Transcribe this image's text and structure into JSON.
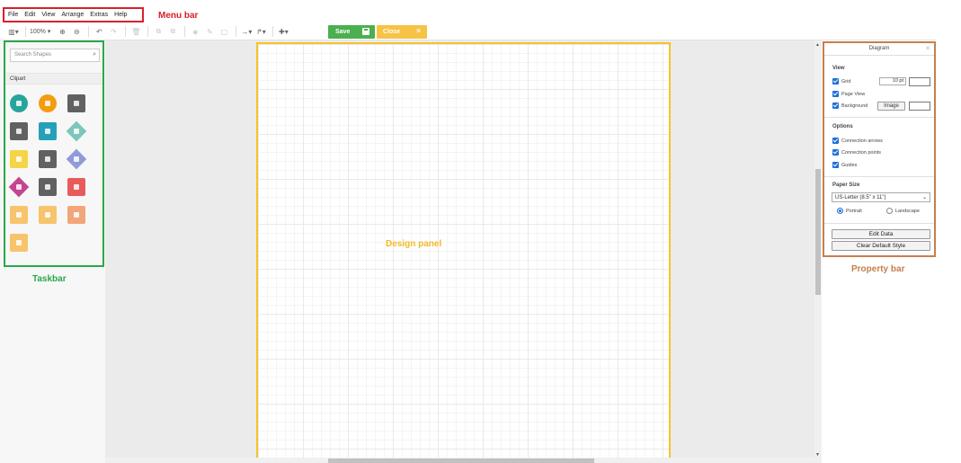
{
  "menu": {
    "items": [
      "File",
      "Edit",
      "View",
      "Arrange",
      "Extras",
      "Help"
    ]
  },
  "annotations": {
    "menu_bar": "Menu bar",
    "taskbar": "Taskbar",
    "design_panel": "Design panel",
    "property_bar": "Property bar"
  },
  "toolbar": {
    "zoom": "100%",
    "save_label": "Save",
    "close_label": "Close"
  },
  "sidebar": {
    "search_placeholder": "Search Shapes",
    "section_title": "Clipart",
    "shape_colors": [
      "#26a69a",
      "#f39c12",
      "#616161",
      "#616161",
      "#26a0b8",
      "#7cc6bc",
      "#f5d547",
      "#616161",
      "#8f9bd9",
      "#c4458f",
      "#616161",
      "#e85b5b",
      "#f7c46c",
      "#f7c46c",
      "#f2a57b",
      "#f7c46c"
    ]
  },
  "properties": {
    "title": "Diagram",
    "view": {
      "label": "View",
      "grid": "Grid",
      "grid_size": "10 pt",
      "page_view": "Page View",
      "background": "Background",
      "image_button": "Image"
    },
    "options": {
      "label": "Options",
      "connection_arrows": "Connection arrows",
      "connection_points": "Connection points",
      "guides": "Guides"
    },
    "paper": {
      "label": "Paper Size",
      "selected": "US-Letter (8.5\" x 11\")",
      "portrait": "Portrait",
      "landscape": "Landscape"
    },
    "edit_data": "Edit Data",
    "clear_style": "Clear Default Style"
  },
  "colors": {
    "menu_border": "#d8202a",
    "taskbar_border": "#2aa84a",
    "design_border": "#f5c32a",
    "property_border": "#c67f4c",
    "save_button": "#4caf50",
    "close_button": "#f6c344"
  }
}
